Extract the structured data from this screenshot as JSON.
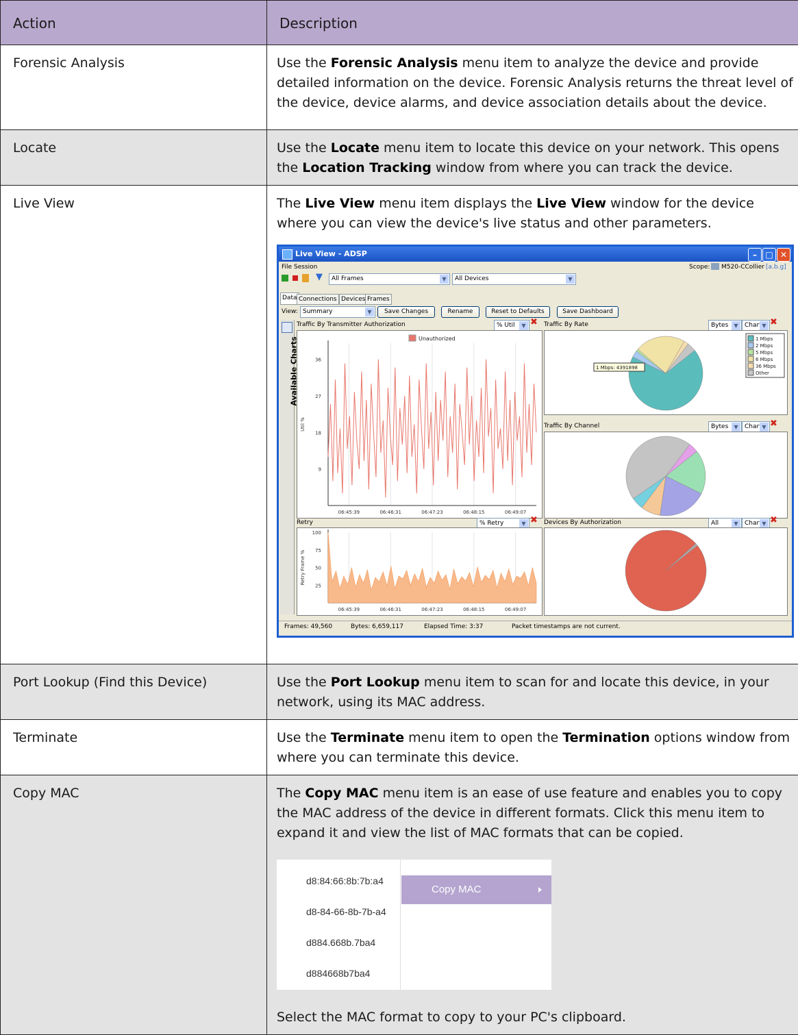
{
  "header": {
    "action": "Action",
    "description": "Description"
  },
  "rows": {
    "forensic": {
      "action": "Forensic Analysis",
      "d1": "Use the ",
      "b1": "Forensic Analysis",
      "d2": " menu item to analyze the device and provide detailed information on the device. Forensic Analysis returns the threat level of the device, device alarms, and device association details about the device."
    },
    "locate": {
      "action": "Locate",
      "d1": "Use the ",
      "b1": "Locate",
      "d2": " menu item to locate this device on your network. This opens the ",
      "b2": "Location Tracking",
      "d3": " window from where you can track the device."
    },
    "liveview": {
      "action": "Live View",
      "d1": "The ",
      "b1": "Live View",
      "d2": " menu item displays the ",
      "b2": "Live View",
      "d3": " window for the device where you can view the device's live status and other parameters."
    },
    "portlookup": {
      "action": "Port Lookup (Find this Device)",
      "d1": "Use the ",
      "b1": "Port Lookup",
      "d2": " menu item to scan for and locate this device, in your network, using its MAC address."
    },
    "terminate": {
      "action": "Terminate",
      "d1": "Use the ",
      "b1": "Terminate",
      "d2": " menu item to open the ",
      "b2": "Termination",
      "d3": " options window from where you can terminate this device."
    },
    "copymac": {
      "action": "Copy MAC",
      "d1": "The ",
      "b1": "Copy MAC",
      "d2": " menu item is an ease of use feature and enables you to copy the MAC address of the device in different formats. Click this menu item to expand it and view the list of MAC formats that can be copied.",
      "after": "Select the MAC format to copy to your PC's clipboard."
    }
  },
  "liveview_window": {
    "title": "Live View - ADSP",
    "menu": [
      "File",
      "Session"
    ],
    "scope_label": "Scope:",
    "scope_value": "M520-CCollier",
    "scope_band": "[a.b.g]",
    "frames_filter": "All Frames",
    "devices_filter": "All Devices",
    "tabs": [
      "Data",
      "Connections",
      "Devices",
      "Frames"
    ],
    "view_label": "View:",
    "view_value": "Summary",
    "buttons": [
      "Save Changes",
      "Rename",
      "Reset to Defaults",
      "Save Dashboard"
    ],
    "side_label": "Available Charts",
    "status": {
      "frames": "Frames: 49,560",
      "bytes": "Bytes: 6,659,117",
      "elapsed": "Elapsed Time: 3:37",
      "note": "Packet timestamps are not current."
    }
  },
  "chart_data": [
    {
      "type": "line",
      "title": "Traffic By Transmitter Authorization",
      "unit_select": "% Util",
      "ylabel": "Util %",
      "legend": [
        "Unauthorized"
      ],
      "yticks": [
        9,
        18,
        27,
        36
      ],
      "ylim": [
        0,
        40
      ],
      "x": [
        "06:45:39",
        "06:46:31",
        "06:47:23",
        "06:48:15",
        "06:49:07"
      ],
      "color": "#e8766b",
      "series": [
        {
          "name": "Unauthorized",
          "values": [
            12,
            25,
            6,
            31,
            8,
            19,
            3,
            35,
            14,
            22,
            5,
            28,
            16,
            9,
            33,
            11,
            26,
            4,
            30,
            18,
            7,
            36,
            13,
            21,
            2,
            29,
            17,
            10,
            34,
            6,
            24,
            15,
            27,
            8,
            32,
            12,
            20,
            3,
            31,
            19,
            9,
            35,
            14,
            23,
            5,
            28,
            11,
            26,
            16,
            33,
            7,
            22,
            13,
            30,
            4,
            25,
            18,
            10,
            34,
            15,
            27,
            6,
            21,
            12,
            29,
            8,
            36,
            17,
            24,
            3,
            31,
            14,
            19,
            9,
            33,
            11,
            26,
            5,
            28,
            16,
            22,
            7,
            35,
            13,
            25,
            10,
            30,
            18
          ]
        }
      ]
    },
    {
      "type": "pie",
      "title": "Traffic By Rate",
      "unit_select": "Bytes",
      "chart_select": "Chart",
      "tooltip": "1 Mbps: 4391898",
      "categories": [
        "1 Mbps",
        "2 Mbps",
        "5 Mbps",
        "6 Mbps",
        "36 Mbps",
        "Other"
      ],
      "values": [
        68,
        3,
        1,
        22,
        2,
        4
      ],
      "colors": [
        "#5bbcbc",
        "#a9c9f0",
        "#b9e3a0",
        "#f1e2a6",
        "#f6ddb0",
        "#c5c5c5"
      ]
    },
    {
      "type": "pie",
      "title": "Traffic By Channel",
      "unit_select": "Bytes",
      "chart_select": "Chart",
      "values": [
        18,
        20,
        8,
        5,
        45,
        4
      ],
      "colors": [
        "#9be0b3",
        "#a3a3e6",
        "#f5c897",
        "#75d0e0",
        "#c4c4c4",
        "#e4a0e8"
      ]
    },
    {
      "type": "area",
      "title": "Retry",
      "unit_select": "% Retry",
      "ylabel": "Retry Frame %",
      "yticks": [
        25,
        50,
        75,
        100
      ],
      "ylim": [
        0,
        100
      ],
      "x": [
        "06:45:39",
        "06:46:31",
        "06:47:23",
        "06:48:15",
        "06:49:07"
      ],
      "color": "#f8b98b",
      "values": [
        100,
        30,
        45,
        20,
        38,
        26,
        50,
        22,
        40,
        28,
        47,
        18,
        36,
        30,
        44,
        24,
        52,
        20,
        38,
        34,
        46,
        25,
        41,
        30,
        49,
        22,
        36,
        28,
        45,
        32,
        40,
        19,
        48,
        27,
        37,
        31,
        43,
        23,
        51,
        29,
        39,
        33,
        46,
        21,
        42,
        30,
        48,
        26,
        38,
        35,
        44,
        24,
        50,
        28
      ]
    },
    {
      "type": "pie",
      "title": "Devices By Authorization",
      "unit_select": "All",
      "chart_select": "Chart",
      "values": [
        99,
        1
      ],
      "colors": [
        "#e06251",
        "#aaaaaa"
      ]
    }
  ],
  "mac_formats": [
    "d8:84:66:8b:7b:a4",
    "d8-84-66-8b-7b-a4",
    "d884.668b.7ba4",
    "d884668b7ba4"
  ],
  "mac_menu_label": "Copy MAC"
}
